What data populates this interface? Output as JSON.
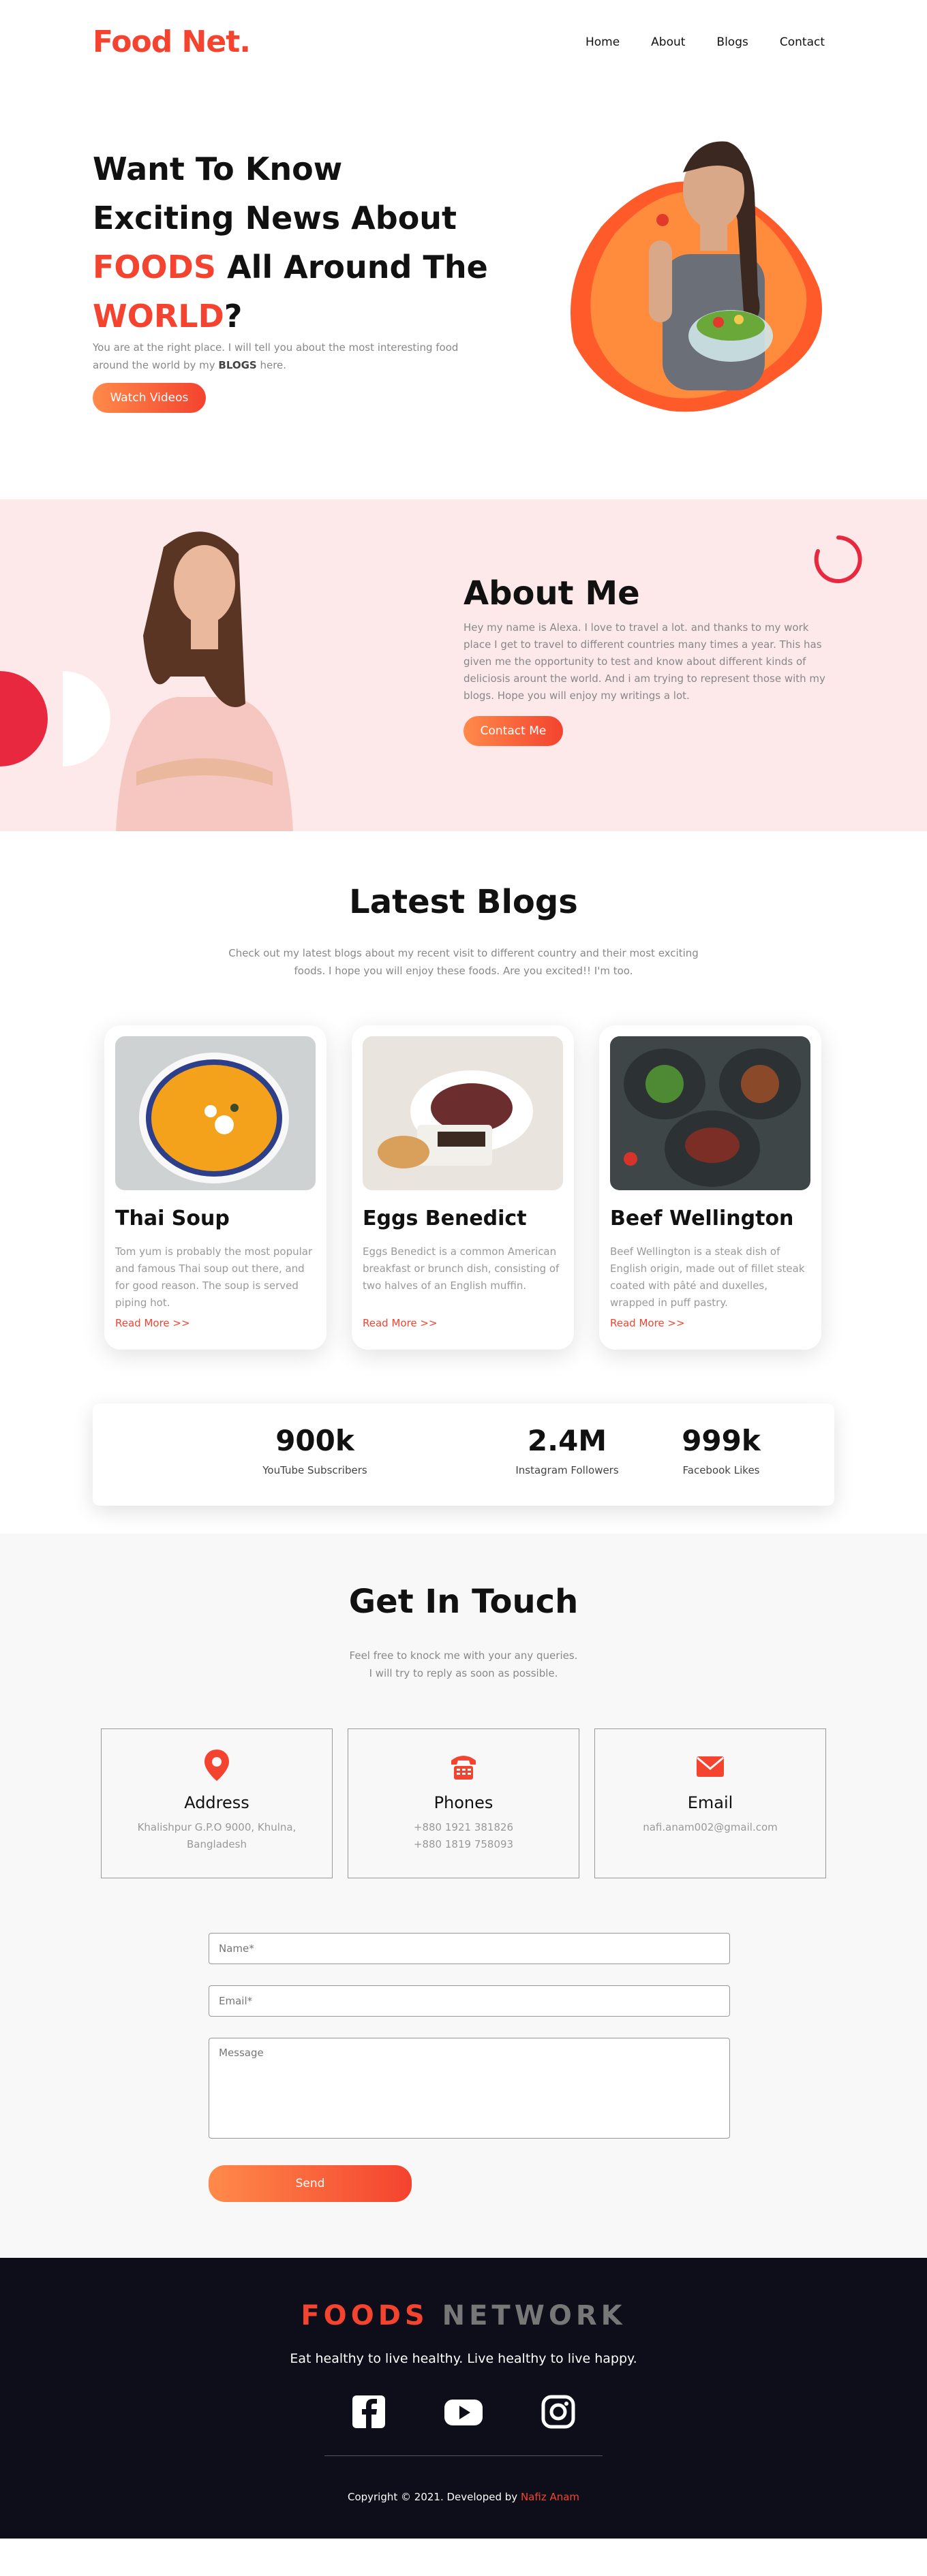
{
  "nav": {
    "logo": "Food Net.",
    "items": [
      "Home",
      "About",
      "Blogs",
      "Contact"
    ]
  },
  "hero": {
    "line1": "Want To Know",
    "line2": "Exciting News About",
    "line3_accent": "FOODS",
    "line3_rest": " All Around The",
    "line4_accent": "WORLD",
    "line4_rest": "?",
    "desc_before": "You are at the right place. I will tell you about the most interesting food around the world by my ",
    "desc_bold": "BLOGS",
    "desc_after": " here.",
    "button": "Watch Videos"
  },
  "about": {
    "title": "About Me",
    "desc": "Hey my name is Alexa. I love to travel a lot. and thanks to my work place I get to travel to different countries many times a year. This has given me the opportunity to test and know about different kinds of deliciosis arount the world. And i am trying to represent those with my blogs. Hope you will enjoy my writings a lot.",
    "button": "Contact Me"
  },
  "blogs": {
    "title": "Latest Blogs",
    "desc": "Check out my latest blogs about my recent visit to different country and their most exciting foods. I hope you will enjoy these foods. Are you excited!! I'm too.",
    "cards": [
      {
        "title": "Thai Soup",
        "text": "Tom yum is probably the most popular and famous Thai soup out there, and for good reason. The soup is served piping hot.",
        "link": "Read More >>"
      },
      {
        "title": "Eggs Benedict",
        "text": "Eggs Benedict is a common American breakfast or brunch dish, consisting of two halves of an English muffin.",
        "link": "Read More >>"
      },
      {
        "title": "Beef Wellington",
        "text": "Beef Wellington is a steak dish of English origin, made out of fillet steak coated with pâté and duxelles, wrapped in puff pastry.",
        "link": "Read More >>"
      }
    ]
  },
  "stats": [
    {
      "value": "900k",
      "label": "YouTube Subscribers"
    },
    {
      "value": "2.4M",
      "label": "Instagram Followers"
    },
    {
      "value": "999k",
      "label": "Facebook Likes"
    }
  ],
  "contact": {
    "title": "Get In Touch",
    "desc1": "Feel free to knock me with your any queries.",
    "desc2": "I will try to reply as soon as possible.",
    "boxes": [
      {
        "title": "Address",
        "line1": "Khalishpur G.P.O 9000, Khulna,",
        "line2": "Bangladesh",
        "icon": "location-pin-icon"
      },
      {
        "title": "Phones",
        "line1": "+880 1921 381826",
        "line2": "+880 1819 758093",
        "icon": "telephone-icon"
      },
      {
        "title": "Email",
        "line1": "nafi.anam002@gmail.com",
        "line2": "",
        "icon": "envelope-icon"
      }
    ],
    "form": {
      "name_placeholder": "Name*",
      "email_placeholder": "Email*",
      "message_placeholder": "Message",
      "send": "Send"
    }
  },
  "footer": {
    "brand_a": "FOODS",
    "brand_b": " NETWORK",
    "tagline": "Eat healthy to live healthy. Live healthy to live happy.",
    "copyright": "Copyright © 2021. Developed by ",
    "author": "Nafiz Anam"
  },
  "colors": {
    "accent": "#f4432f",
    "accent_light": "#ff8a4a",
    "about_bg": "#fde8ea",
    "footer_bg": "#0d0e19"
  }
}
